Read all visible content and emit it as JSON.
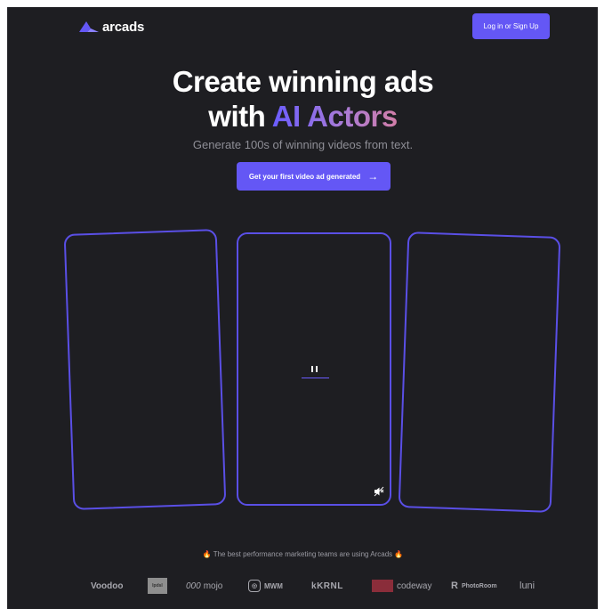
{
  "header": {
    "logo_text": "arcads",
    "login_label": "Log in or Sign Up"
  },
  "hero": {
    "title_line1": "Create winning ads",
    "title_line2_prefix": "with ",
    "title_line2_accent": "AI Actors",
    "subtitle": "Generate 100s of winning videos from text.",
    "cta_label": "Get your first video ad generated",
    "cta_icon": "arrow-right-icon"
  },
  "video_cards": [
    {
      "position": "left"
    },
    {
      "position": "center",
      "controls": [
        "pause-icon",
        "mute-icon"
      ]
    },
    {
      "position": "right"
    }
  ],
  "social_proof": {
    "text": "🔥 The best performance marketing teams are using Arcads 🔥",
    "brands": [
      {
        "name": "Voodoo"
      },
      {
        "name": "Ipdsl"
      },
      {
        "name": "mojo",
        "prefix": "000"
      },
      {
        "name": "MWM"
      },
      {
        "name": "KRNL"
      },
      {
        "name": "codeway"
      },
      {
        "name": "PhotoRoom"
      },
      {
        "name": "luni"
      }
    ]
  },
  "colors": {
    "background": "#1e1e22",
    "accent": "#6457f5",
    "card_border": "#5a4fe6",
    "text_muted": "#8e8e96"
  }
}
